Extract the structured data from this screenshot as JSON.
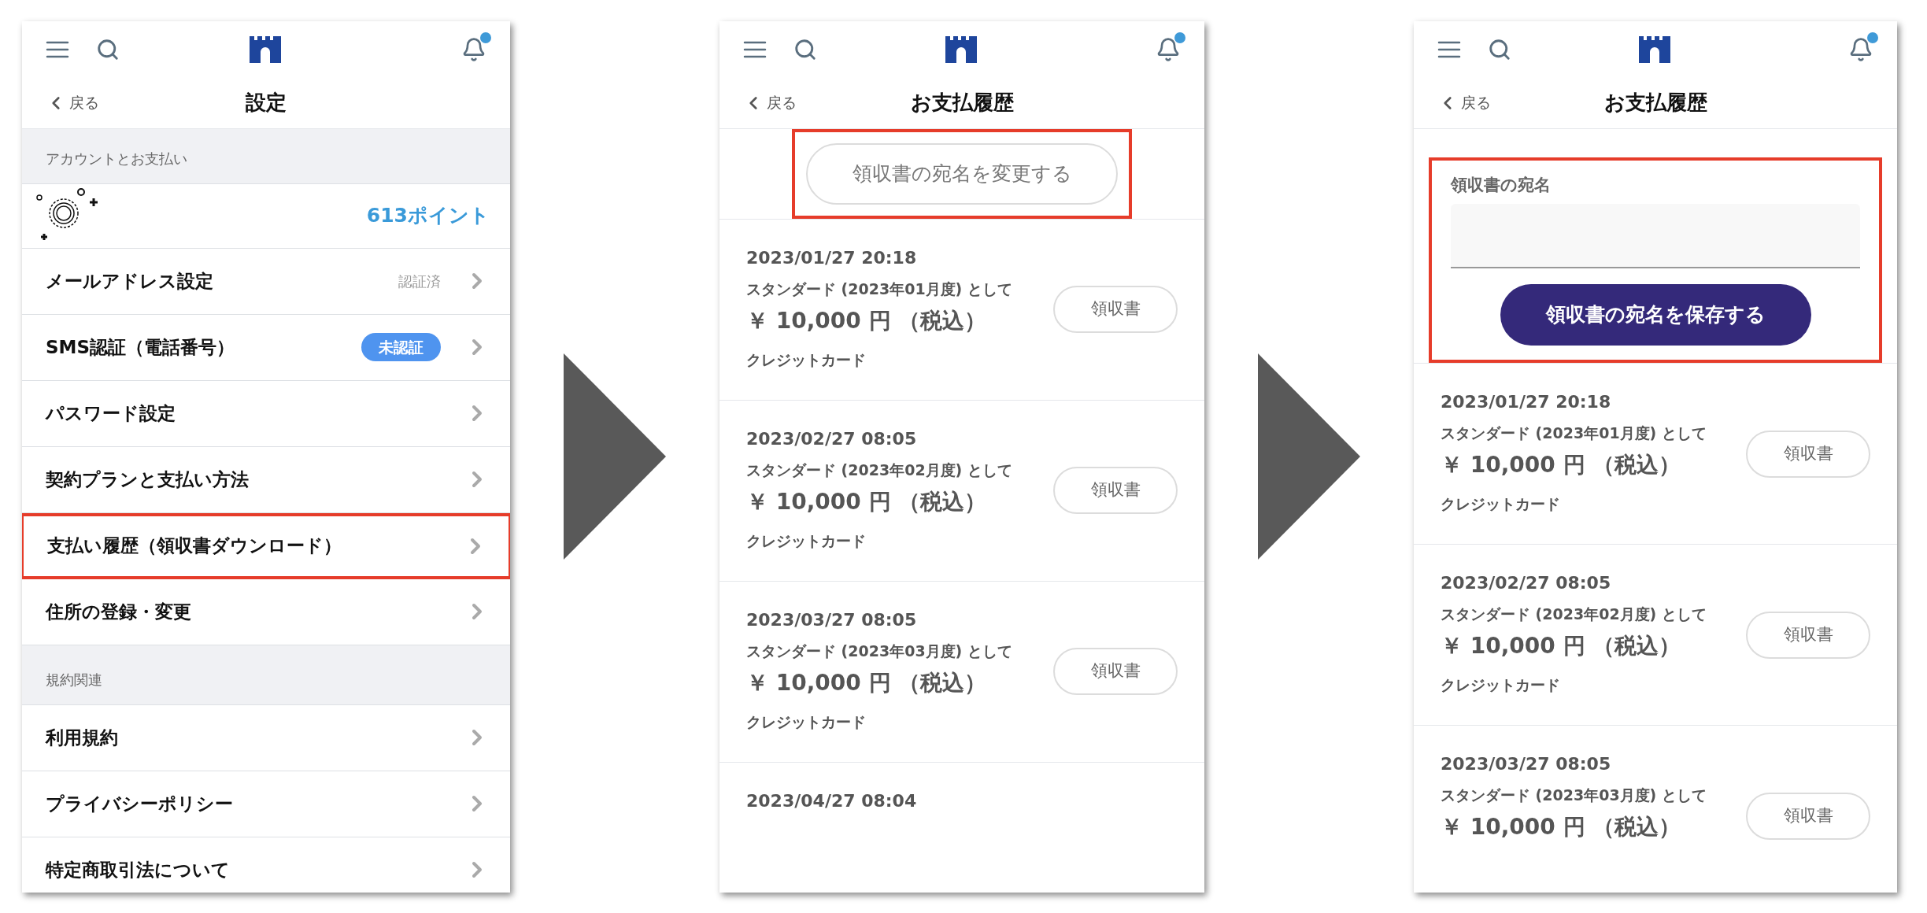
{
  "screens": [
    {
      "kind": "settings",
      "has_notification": true,
      "back": "戻る",
      "title": "設定",
      "sections": [
        {
          "heading": "アカウントとお支払い",
          "items": [
            {
              "kind": "points",
              "value": "613ポイント",
              "highlighted": false
            },
            {
              "kind": "link",
              "label": "メールアドレス設定",
              "status": "認証済",
              "highlighted": false
            },
            {
              "kind": "link",
              "label": "SMS認証（電話番号）",
              "badge": "未認証",
              "highlighted": false
            },
            {
              "kind": "link",
              "label": "パスワード設定",
              "highlighted": false
            },
            {
              "kind": "link",
              "label": "契約プランと支払い方法",
              "highlighted": false
            },
            {
              "kind": "link",
              "label": "支払い履歴（領収書ダウンロード）",
              "highlighted": true
            },
            {
              "kind": "link",
              "label": "住所の登録・変更",
              "highlighted": false
            }
          ]
        },
        {
          "heading": "規約関連",
          "items": [
            {
              "kind": "link",
              "label": "利用規約",
              "highlighted": false
            },
            {
              "kind": "link",
              "label": "プライバシーポリシー",
              "highlighted": false
            },
            {
              "kind": "link",
              "label": "特定商取引法について",
              "highlighted": false
            }
          ]
        }
      ]
    },
    {
      "kind": "history",
      "has_notification": true,
      "back": "戻る",
      "title": "お支払履歴",
      "top": {
        "kind": "change_button",
        "label": "領収書の宛名を変更する",
        "highlighted": true
      },
      "payments": [
        {
          "date": "2023/01/27 20:18",
          "plan": "スタンダード (2023年01月度) として",
          "price": "￥ 10,000 円 （税込）",
          "method": "クレジットカード",
          "button": "領収書"
        },
        {
          "date": "2023/02/27 08:05",
          "plan": "スタンダード (2023年02月度) として",
          "price": "￥ 10,000 円 （税込）",
          "method": "クレジットカード",
          "button": "領収書"
        },
        {
          "date": "2023/03/27 08:05",
          "plan": "スタンダード (2023年03月度) として",
          "price": "￥ 10,000 円 （税込）",
          "method": "クレジットカード",
          "button": "領収書"
        },
        {
          "date": "2023/04/27 08:04"
        }
      ]
    },
    {
      "kind": "history",
      "has_notification": true,
      "back": "戻る",
      "title": "お支払履歴",
      "top": {
        "kind": "name_form",
        "label": "領収書の宛名",
        "button": "領収書の宛名を保存する",
        "highlighted": true
      },
      "payments": [
        {
          "date": "2023/01/27 20:18",
          "plan": "スタンダード (2023年01月度) として",
          "price": "￥ 10,000 円 （税込）",
          "method": "クレジットカード",
          "button": "領収書"
        },
        {
          "date": "2023/02/27 08:05",
          "plan": "スタンダード (2023年02月度) として",
          "price": "￥ 10,000 円 （税込）",
          "method": "クレジットカード",
          "button": "領収書"
        },
        {
          "date": "2023/03/27 08:05",
          "plan": "スタンダード (2023年03月度) として",
          "price": "￥ 10,000 円 （税込）",
          "button": "領収書"
        }
      ]
    }
  ]
}
